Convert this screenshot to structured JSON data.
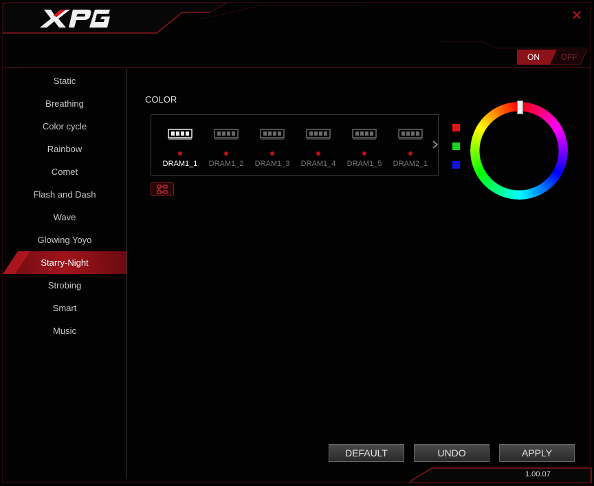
{
  "app": {
    "logo_text": "XPG",
    "power_on_label": "ON",
    "power_off_label": "OFF",
    "power_state": "on"
  },
  "sidebar": {
    "items": [
      {
        "label": "Static"
      },
      {
        "label": "Breathing"
      },
      {
        "label": "Color cycle"
      },
      {
        "label": "Rainbow"
      },
      {
        "label": "Comet"
      },
      {
        "label": "Flash and Dash"
      },
      {
        "label": "Wave"
      },
      {
        "label": "Glowing Yoyo"
      },
      {
        "label": "Starry-Night"
      },
      {
        "label": "Strobing"
      },
      {
        "label": "Smart"
      },
      {
        "label": "Music"
      }
    ],
    "active": "Starry-Night"
  },
  "main": {
    "color_title": "COLOR",
    "modules": [
      {
        "label": "DRAM1_1",
        "selected": true
      },
      {
        "label": "DRAM1_2",
        "selected": false
      },
      {
        "label": "DRAM1_3",
        "selected": false
      },
      {
        "label": "DRAM1_4",
        "selected": false
      },
      {
        "label": "DRAM1_5",
        "selected": false
      },
      {
        "label": "DRAM2_1",
        "selected": false
      }
    ],
    "swatches": [
      "#e0141a",
      "#18d41e",
      "#1414e0"
    ],
    "accent_color": "#b01218"
  },
  "buttons": {
    "default_label": "DEFAULT",
    "undo_label": "UNDO",
    "apply_label": "APPLY"
  },
  "footer": {
    "version": "1.00.07"
  },
  "icons": {
    "close": "close-icon",
    "next": "chevron-right-icon",
    "link": "link-modules-icon",
    "ram": "ram-module-icon"
  }
}
